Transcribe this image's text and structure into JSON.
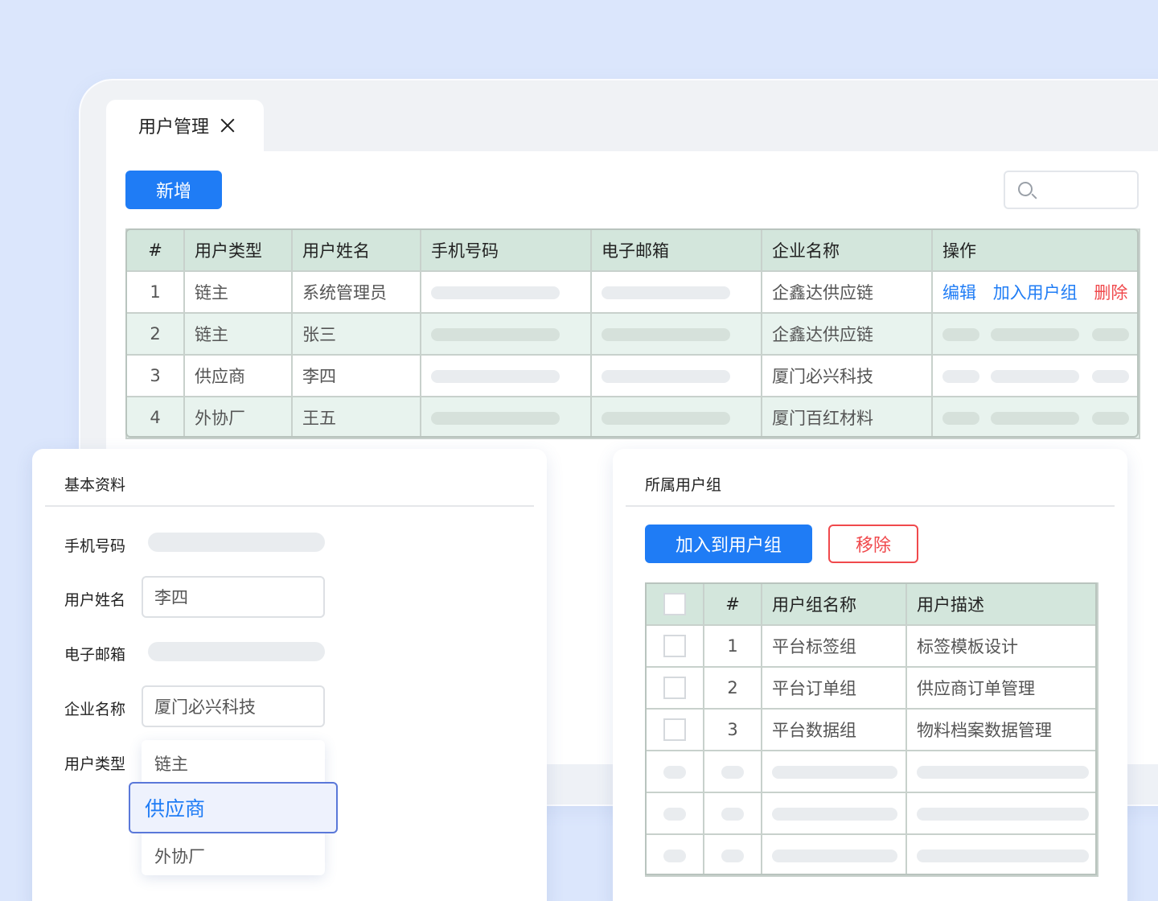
{
  "tab": {
    "label": "用户管理"
  },
  "toolbar": {
    "add_label": "新增",
    "search_placeholder": ""
  },
  "users_table": {
    "headers": [
      "#",
      "用户类型",
      "用户姓名",
      "手机号码",
      "电子邮箱",
      "企业名称",
      "操作"
    ],
    "rows": [
      {
        "no": "1",
        "type": "链主",
        "name": "系统管理员",
        "company": "企鑫达供应链"
      },
      {
        "no": "2",
        "type": "链主",
        "name": "张三",
        "company": "企鑫达供应链"
      },
      {
        "no": "3",
        "type": "供应商",
        "name": "李四",
        "company": "厦门必兴科技"
      },
      {
        "no": "4",
        "type": "外协厂",
        "name": "王五",
        "company": "厦门百红材料"
      }
    ],
    "actions": {
      "edit": "编辑",
      "add_group": "加入用户组",
      "delete": "删除"
    }
  },
  "basic_info": {
    "title": "基本资料",
    "phone_label": "手机号码",
    "name_label": "用户姓名",
    "name_value": "李四",
    "email_label": "电子邮箱",
    "company_label": "企业名称",
    "company_value": "厦门必兴科技",
    "type_label": "用户类型",
    "type_options": [
      "链主",
      "供应商",
      "外协厂"
    ],
    "type_selected": "供应商"
  },
  "groups": {
    "title": "所属用户组",
    "join_label": "加入到用户组",
    "remove_label": "移除",
    "headers": [
      "#",
      "用户组名称",
      "用户描述"
    ],
    "rows": [
      {
        "no": "1",
        "name": "平台标签组",
        "desc": "标签模板设计"
      },
      {
        "no": "2",
        "name": "平台订单组",
        "desc": "供应商订单管理"
      },
      {
        "no": "3",
        "name": "平台数据组",
        "desc": "物料档案数据管理"
      }
    ]
  },
  "colors": {
    "primary": "#1f7cf5",
    "danger": "#f0494c",
    "header_green": "#d3e6dc",
    "background": "#dbe6fc"
  }
}
